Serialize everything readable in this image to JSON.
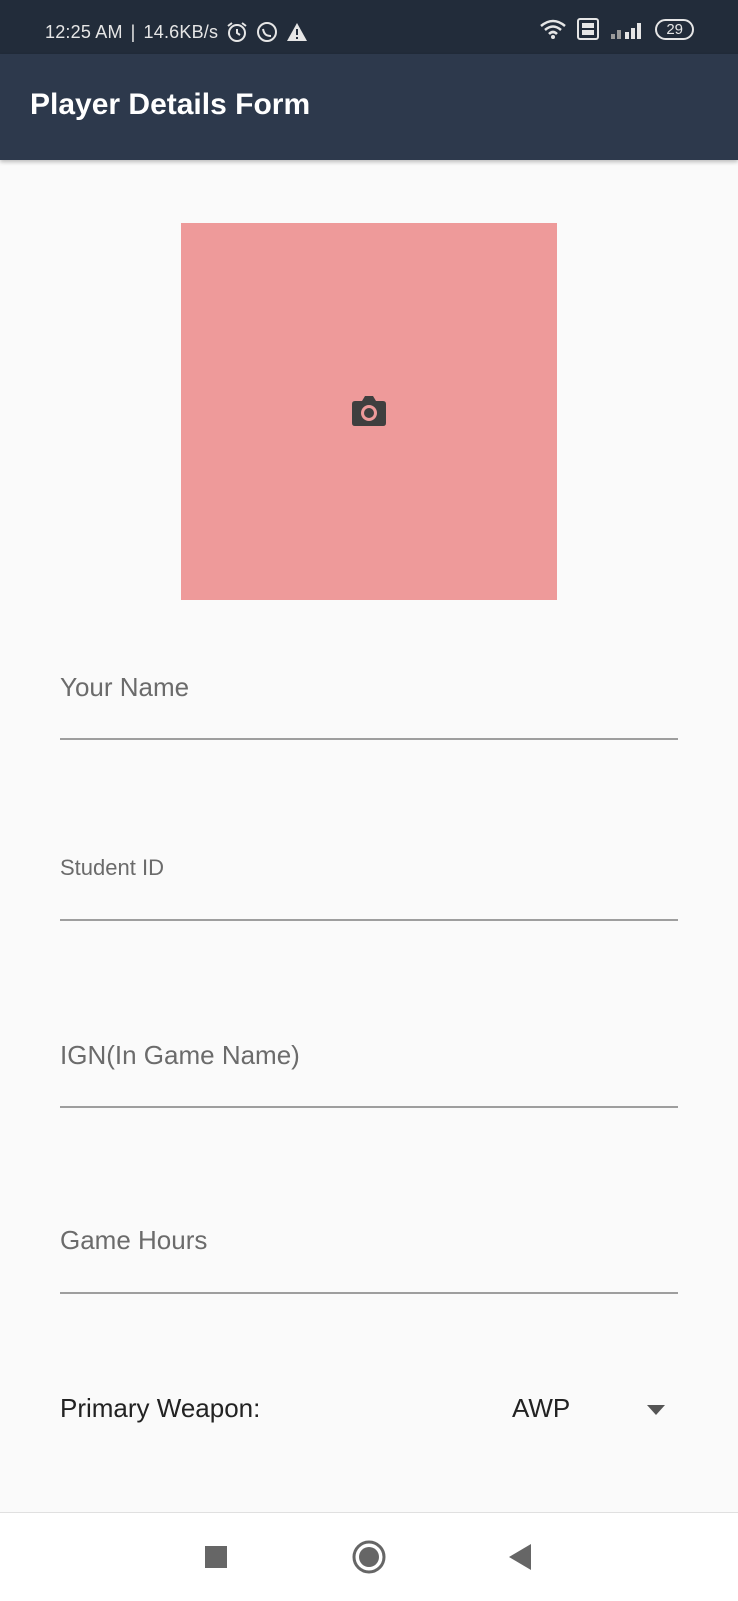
{
  "status_bar": {
    "time": "12:25 AM",
    "separator": "|",
    "network_speed": "14.6KB/s",
    "battery": "29",
    "icons": [
      "alarm-icon",
      "whatsapp-icon",
      "warning-icon",
      "wifi-icon",
      "volte-icon",
      "signal-icon",
      "battery-icon"
    ]
  },
  "app_bar": {
    "title": "Player Details Form",
    "color": "#2d394c"
  },
  "photo_picker": {
    "background": "#ee9a9a",
    "icon": "camera-icon"
  },
  "form": {
    "fields": [
      {
        "name": "Your Name",
        "value": ""
      },
      {
        "name": "Student ID",
        "value": ""
      },
      {
        "name": "IGN(In Game Name)",
        "value": ""
      },
      {
        "name": "Game Hours",
        "value": ""
      }
    ],
    "weapon": {
      "label": "Primary Weapon:",
      "value": "AWP",
      "icon": "dropdown-arrow-icon"
    }
  },
  "nav_bar": {
    "icons": [
      "recents-icon",
      "home-icon",
      "back-icon"
    ]
  }
}
